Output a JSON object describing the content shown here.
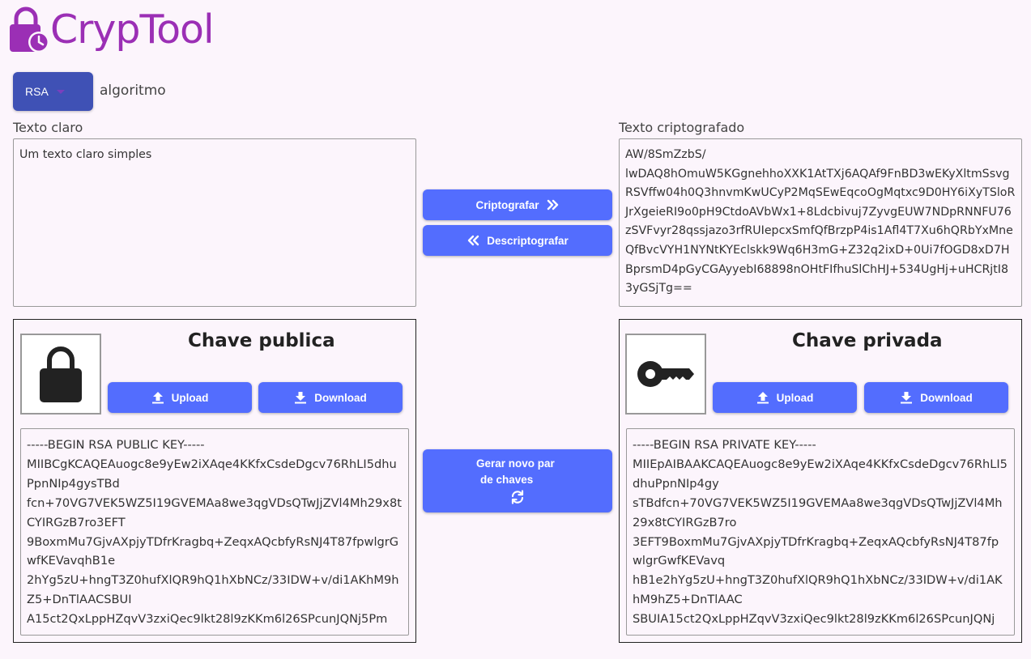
{
  "app": {
    "title": "CrypTool",
    "logo_icon": "lock-clock-icon",
    "brand_color": "#9b2fb5"
  },
  "algorithm": {
    "selected": "RSA",
    "label": "algoritmo"
  },
  "plaintext": {
    "label": "Texto claro",
    "value": "Um texto claro simples"
  },
  "ciphertext": {
    "label": "Texto criptografado",
    "value": "AW/8SmZzbS/\nlwDAQ8hOmuW5KGgnehhoXXK1AtTXj6AQAf9FnBD3wEKyXltmSsvgRSVffw04h0Q3hnvmKwUCyP2MqSEwEqcoOgMqtxc9D0HY6iXyTSloRJrXgeieRI9o0pH9CtdoAVbWx1+8Ldcbivuj7ZyvgEUW7NDpRNNFU76zSVFvyr28qssjazo3rfRUIepcxSmfQfBrzpP4is1Afl4T7Xu6hQRbYxMneQfBvcVYH1NYNtKYEclskk9Wq6H3mG+Z32q2ixD+0Ui7fOGD8xD7HBprsmD4pGyCGAyyebI68898nOHtFIfhuSlChHJ+534UgHj+uHCRjtI83yGSjTg=="
  },
  "actions": {
    "encrypt_label": "Criptografar",
    "decrypt_label": "Descriptografar",
    "generate_line1": "Gerar novo par",
    "generate_line2": "de chaves",
    "button_color": "#536dfe"
  },
  "public_key": {
    "title": "Chave publica",
    "icon": "lock-icon",
    "upload_label": "Upload",
    "download_label": "Download",
    "value": "-----BEGIN RSA PUBLIC KEY-----\nMIIBCgKCAQEAuogc8e9yEw2iXAqe4KKfxCsdeDgcv76RhLI5dhuPpnNIp4gysTBd\nfcn+70VG7VEK5WZ5I19GVEMAa8we3qgVDsQTwJjZVl4Mh29x8tCYIRGzB7ro3EFT\n9BoxmMu7GjvAXpjyTDfrKragbq+ZeqxAQcbfyRsNJ4T87fpwlgrGwfKEVavqhB1e\n2hYg5zU+hngT3Z0hufXlQR9hQ1hXbNCz/33IDW+v/di1AKhM9hZ5+DnTlAACSBUI\nA15ct2QxLppHZqvV3zxiQec9lkt28l9zKKm6l26SPcunJQNj5Pm"
  },
  "private_key": {
    "title": "Chave privada",
    "icon": "key-icon",
    "upload_label": "Upload",
    "download_label": "Download",
    "value": "-----BEGIN RSA PRIVATE KEY-----\nMIIEpAIBAAKCAQEAuogc8e9yEw2iXAqe4KKfxCsdeDgcv76RhLI5dhuPpnNIp4gy\nsTBdfcn+70VG7VEK5WZ5I19GVEMAa8we3qgVDsQTwJjZVl4Mh29x8tCYIRGzB7ro\n3EFT9BoxmMu7GjvAXpjyTDfrKragbq+ZeqxAQcbfyRsNJ4T87fpwlgrGwfKEVavq\nhB1e2hYg5zU+hngT3Z0hufXlQR9hQ1hXbNCz/33IDW+v/di1AKhM9hZ5+DnTlAAC\nSBUIA15ct2QxLppHZqvV3zxiQec9lkt28l9zKKm6l26SPcunJQNj"
  }
}
